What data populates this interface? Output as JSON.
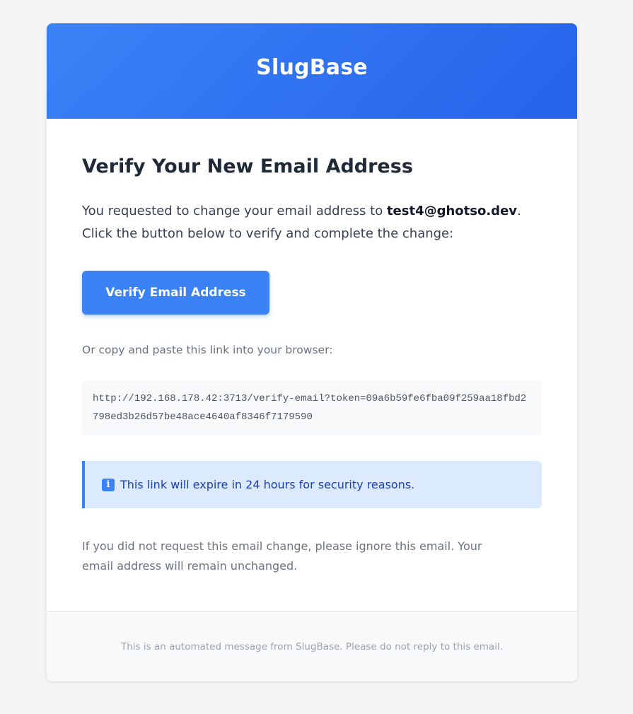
{
  "colors": {
    "page_background": "#f4f4f5",
    "header_gradient_start": "#3b82f6",
    "header_gradient_end": "#2563eb",
    "button": "#3b82f6",
    "notice_background": "#dbeafe",
    "notice_text": "#1e40af"
  },
  "header": {
    "brand": "SlugBase"
  },
  "content": {
    "title": "Verify Your New Email Address",
    "intro_before": "You requested to change your email address to ",
    "new_email": "test4@ghotso.dev",
    "intro_after": ". Click the button below to verify and complete the change:",
    "verify_button_label": "Verify Email Address",
    "copy_hint": "Or copy and paste this link into your browser:",
    "verify_link": "http://192.168.178.42:3713/verify-email?token=09a6b59fe6fba09f259aa18fbd2798ed3b26d57be48ace4640af8346f7179590",
    "notice": {
      "icon": "info-icon",
      "icon_glyph": "i",
      "text": "This link will expire in 24 hours for security reasons."
    },
    "disclaimer": "If you did not request this email change, please ignore this email. Your email address will remain unchanged."
  },
  "footer": {
    "text": "This is an automated message from SlugBase. Please do not reply to this email."
  }
}
